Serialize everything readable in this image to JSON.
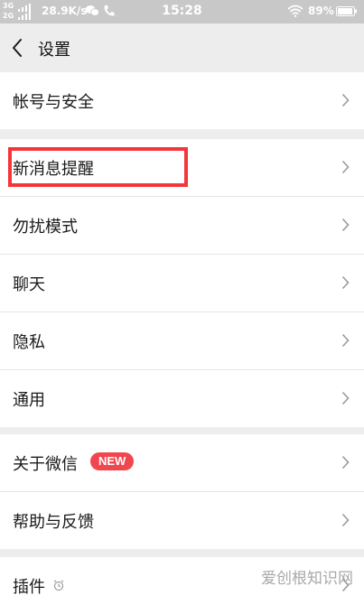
{
  "status_bar": {
    "network_top": "3G",
    "network_bottom": "2G",
    "speed": "28.9K/s",
    "time": "15:28",
    "battery": "89%"
  },
  "header": {
    "title": "设置"
  },
  "groups": [
    {
      "items": [
        {
          "label": "帐号与安全"
        }
      ]
    },
    {
      "items": [
        {
          "label": "新消息提醒"
        },
        {
          "label": "勿扰模式"
        },
        {
          "label": "聊天"
        },
        {
          "label": "隐私"
        },
        {
          "label": "通用"
        }
      ]
    },
    {
      "items": [
        {
          "label": "关于微信",
          "badge": "NEW"
        },
        {
          "label": "帮助与反馈"
        }
      ]
    },
    {
      "items": [
        {
          "label": "插件"
        }
      ]
    }
  ],
  "watermark": "爱创根知识网",
  "colors": {
    "badge": "#f0474f",
    "highlight": "#f4353b",
    "background": "#ededed"
  }
}
